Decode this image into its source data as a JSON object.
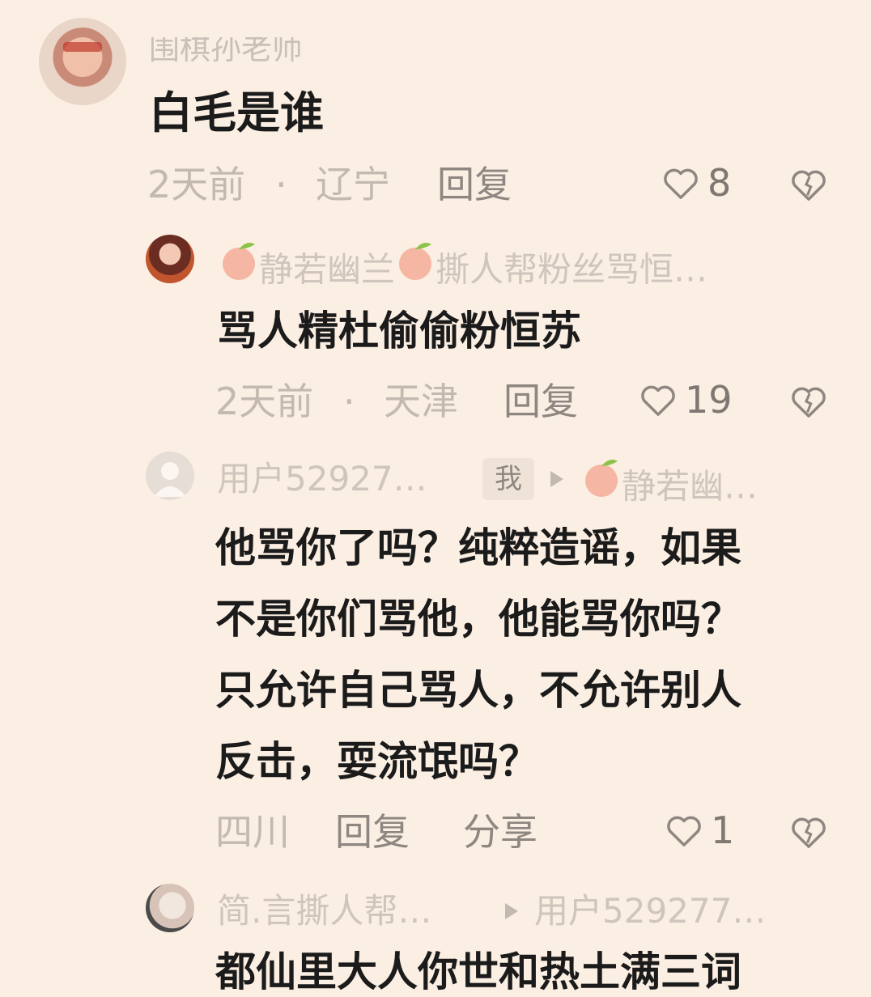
{
  "comments": [
    {
      "author": "围棋孙老师",
      "text": "白毛是谁",
      "time": "2天前",
      "sep": "·",
      "location": "辽宁",
      "reply_label": "回复",
      "likes": "8"
    },
    {
      "author_a": "静若幽兰",
      "author_b": "撕人帮粉丝骂恒…",
      "text": "骂人精杜偷偷粉恒苏",
      "time": "2天前",
      "sep": "·",
      "location": "天津",
      "reply_label": "回复",
      "likes": "19"
    },
    {
      "author": "用户52927…",
      "me_badge": "我",
      "reply_to": "静若幽…",
      "text_lines": [
        "他骂你了吗？纯粹造谣，如果",
        "不是你们骂他，他能骂你吗？",
        "只允许自己骂人，不允许别人",
        "反击，耍流氓吗？"
      ],
      "location": "四川",
      "reply_label": "回复",
      "share_label": "分享",
      "likes": "1"
    },
    {
      "author": "简.言撕人帮…",
      "reply_to": "用户529277…",
      "partial_text": "都仙里大人你世和热土满三词"
    }
  ],
  "icons": {
    "like": "heart-outline-icon",
    "dislike": "broken-heart-icon",
    "badge": "peach-icon",
    "reply_arrow": "triangle-right-icon"
  },
  "colors": {
    "background": "#fbeee2",
    "text": "#1b1b1b",
    "meta": "#c3b9b1",
    "action": "#8e8680"
  }
}
